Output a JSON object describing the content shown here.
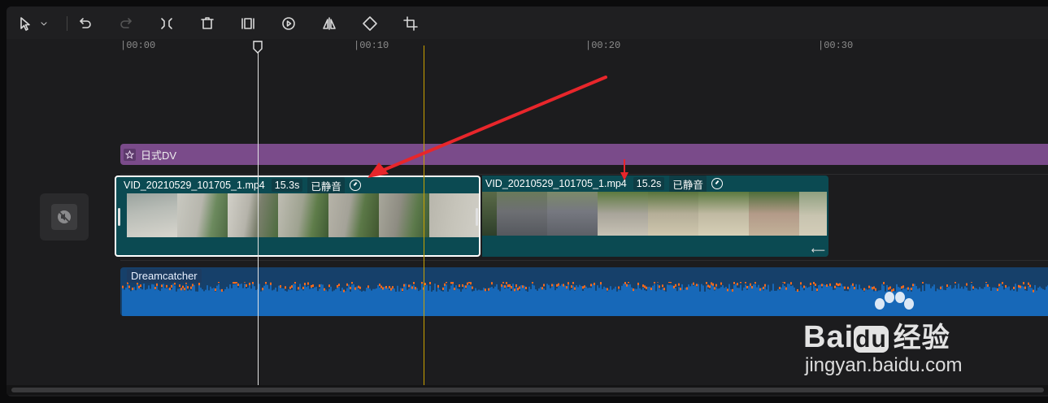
{
  "toolbar": {
    "tools": [
      {
        "name": "select-tool-icon",
        "label": "select"
      },
      {
        "name": "undo-icon",
        "label": "undo"
      },
      {
        "name": "redo-icon",
        "label": "redo"
      },
      {
        "name": "split-icon",
        "label": "split"
      },
      {
        "name": "delete-icon",
        "label": "delete"
      },
      {
        "name": "freeze-frame-icon",
        "label": "freeze"
      },
      {
        "name": "reverse-icon",
        "label": "reverse"
      },
      {
        "name": "mirror-icon",
        "label": "mirror"
      },
      {
        "name": "rotate-icon",
        "label": "rotate"
      },
      {
        "name": "crop-icon",
        "label": "crop"
      }
    ]
  },
  "ruler": {
    "labels": [
      "|00:00",
      "|00:10",
      "|00:20",
      "|00:30"
    ]
  },
  "effect_track": {
    "label": "日式DV",
    "color": "#7a4b8a"
  },
  "clips": [
    {
      "filename": "VID_20210529_101705_1.mp4",
      "duration": "15.3s",
      "status": "已静音",
      "selected": true
    },
    {
      "filename": "VID_20210529_101705_1.mp4",
      "duration": "15.2s",
      "status": "已静音",
      "selected": false
    }
  ],
  "audio_track": {
    "label": "Dreamcatcher",
    "color": "#16406a",
    "wave_color": "#1768b8",
    "peak_color": "#ff6a1a"
  },
  "watermark": {
    "brand": "Bai",
    "du": "du",
    "suffix": "经验",
    "url": "jingyan.baidu.com"
  },
  "colors": {
    "playhead": "#e5e5e5",
    "cursor_line": "#caa200",
    "annotation_arrow": "#e8262b"
  }
}
